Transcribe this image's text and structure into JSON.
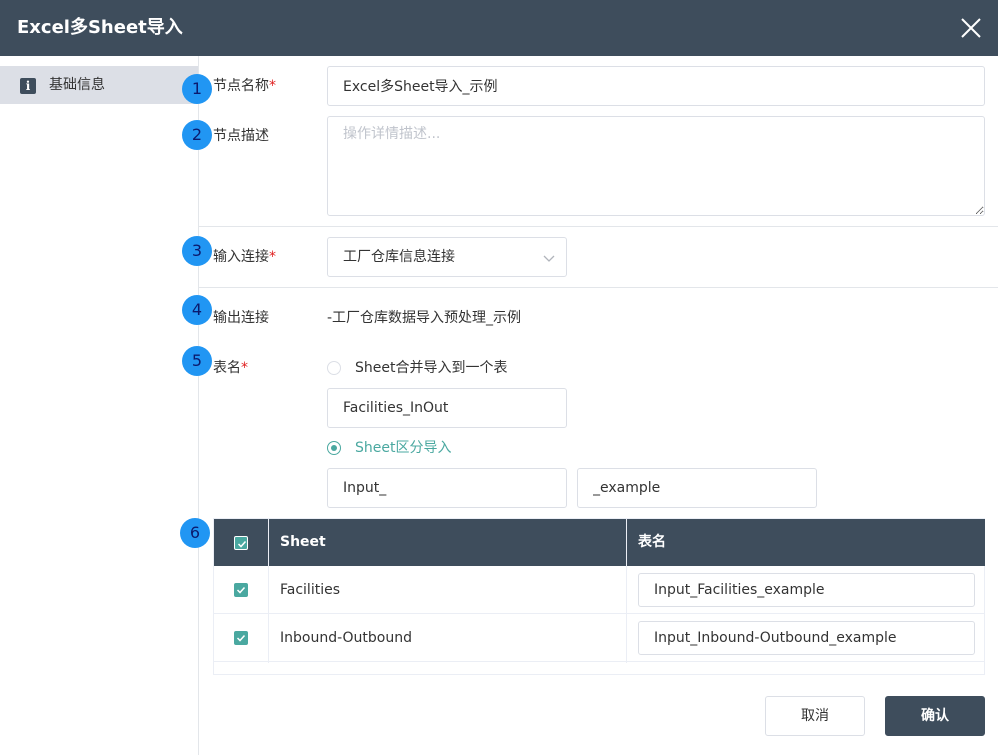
{
  "header": {
    "title": "Excel多Sheet导入",
    "close_icon": "close-icon"
  },
  "sidebar": {
    "items": [
      {
        "label": "基础信息",
        "icon": "info-icon"
      }
    ]
  },
  "badges": [
    "1",
    "2",
    "3",
    "4",
    "5",
    "6"
  ],
  "form": {
    "node_name": {
      "label": "节点名称",
      "required_mark": "*",
      "value": "Excel多Sheet导入_示例"
    },
    "node_desc": {
      "label": "节点描述",
      "placeholder": "操作详情描述..."
    },
    "input_conn": {
      "label": "输入连接",
      "required_mark": "*",
      "value": "工厂仓库信息连接"
    },
    "output_conn": {
      "label": "输出连接",
      "value": "-工厂仓库数据导入预处理_示例"
    },
    "table_name": {
      "label": "表名",
      "required_mark": "*",
      "option_merge": {
        "label": "Sheet合并导入到一个表",
        "checked": false
      },
      "merge_value": "Facilities_InOut",
      "option_split": {
        "label": "Sheet区分导入",
        "checked": true
      },
      "prefix_value": "Input_",
      "suffix_value": "_example"
    }
  },
  "table": {
    "headers": {
      "sheet": "Sheet",
      "table_name": "表名"
    },
    "rows": [
      {
        "sheet": "Facilities",
        "table_name": "Input_Facilities_example",
        "checked": true
      },
      {
        "sheet": "Inbound-Outbound",
        "table_name": "Input_Inbound-Outbound_example",
        "checked": true
      }
    ]
  },
  "footer": {
    "cancel_label": "取消",
    "confirm_label": "确认"
  },
  "colors": {
    "header_bg": "#3e4d5c",
    "accent": "#4aa8a0",
    "badge": "#2196f3",
    "required": "#e02020"
  }
}
